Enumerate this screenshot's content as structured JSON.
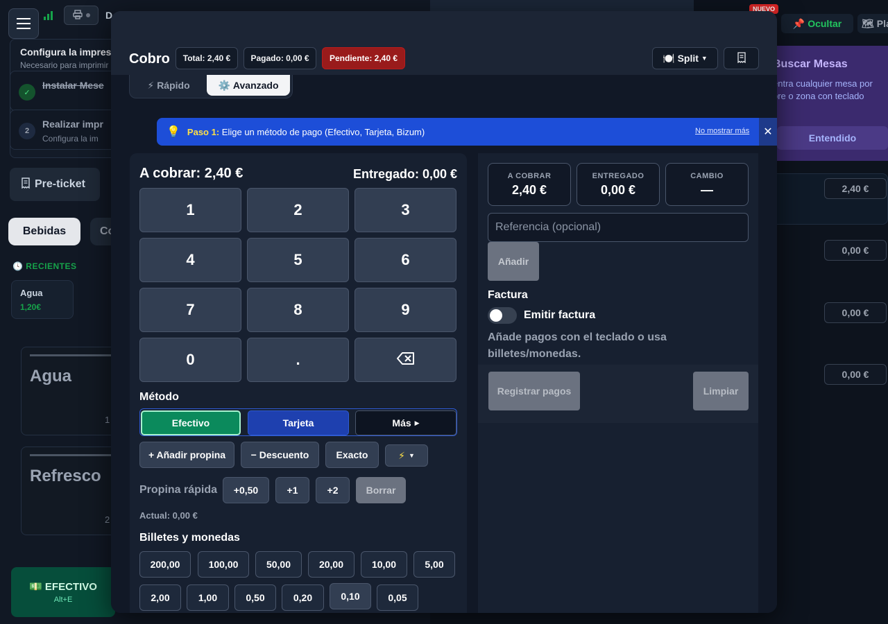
{
  "background": {
    "printer_icon": "printer-icon",
    "d_text": "D",
    "config_title": "Configura la impresi",
    "config_sub": "Necesario para imprimir",
    "step1_text": "Instalar Mese",
    "step2_num": "2",
    "step2_text": "Realizar impr",
    "step2_sub": "Configura la im",
    "preticket": "Pre-ticket",
    "tab_bebidas": "Bebidas",
    "tab_co": "Co",
    "recientes": "RECIENTES",
    "recent_item_name": "Agua",
    "recent_item_price": "1,20€",
    "card1": "Agua",
    "card1_num": "1",
    "card2": "Refresco",
    "card2_num": "2",
    "efectivo_label": "EFECTIVO",
    "efectivo_shortcut": "Alt+E",
    "nuevo_badge": "NUEVO",
    "ocultar": "Ocultar",
    "pla": "Pla",
    "buscar_title": "Buscar Mesas",
    "buscar_desc_1": "entra cualquier mesa por",
    "buscar_desc_2": "bre o zona con teclado",
    "buscar_btn": "Entendido",
    "amounts": [
      "2,40 €",
      "0,00 €",
      "0,00 €",
      "0,00 €"
    ]
  },
  "modal": {
    "title": "Cobro",
    "total": "Total: 2,40 €",
    "pagado": "Pagado: 0,00 €",
    "pendiente": "Pendiente: 2,40 €",
    "split": "Split",
    "mode_rapido": "Rápido",
    "mode_avanzado": "Avanzado",
    "tip_step": "Paso 1:",
    "tip_text": "Elige un método de pago (Efectivo, Tarjeta, Bizum)",
    "tip_hide": "No mostrar más",
    "left": {
      "a_cobrar": "A cobrar: 2,40 €",
      "entregado": "Entregado: 0,00 €",
      "keys": [
        "1",
        "2",
        "3",
        "4",
        "5",
        "6",
        "7",
        "8",
        "9",
        "0",
        ".",
        "⌫"
      ],
      "metodo_label": "Método",
      "methods": [
        "Efectivo",
        "Tarjeta",
        "Más"
      ],
      "add_tip": "+ Añadir propina",
      "discount": "− Descuento",
      "exact": "Exacto",
      "quick_tip_label": "Propina rápida",
      "quick_tips": [
        "+0,50",
        "+1",
        "+2"
      ],
      "quick_tip_clear": "Borrar",
      "actual": "Actual: 0,00 €",
      "billetes_label": "Billetes y monedas",
      "denominations_row1": [
        "200,00",
        "100,00",
        "50,00",
        "20,00",
        "10,00",
        "5,00"
      ],
      "denominations_row2": [
        "2,00",
        "1,00",
        "0,50",
        "0,20",
        "0,10",
        "0,05"
      ]
    },
    "right": {
      "stat_cobrar_label": "A COBRAR",
      "stat_cobrar_value": "2,40 €",
      "stat_entregado_label": "ENTREGADO",
      "stat_entregado_value": "0,00 €",
      "stat_cambio_label": "CAMBIO",
      "stat_cambio_value": "—",
      "reference_placeholder": "Referencia (opcional)",
      "add_button": "Añadir",
      "factura_label": "Factura",
      "emitir_factura": "Emitir factura",
      "hint": "Añade pagos con el teclado o usa billetes/monedas.",
      "register_button": "Registrar pagos",
      "clear_button": "Limpiar"
    }
  }
}
